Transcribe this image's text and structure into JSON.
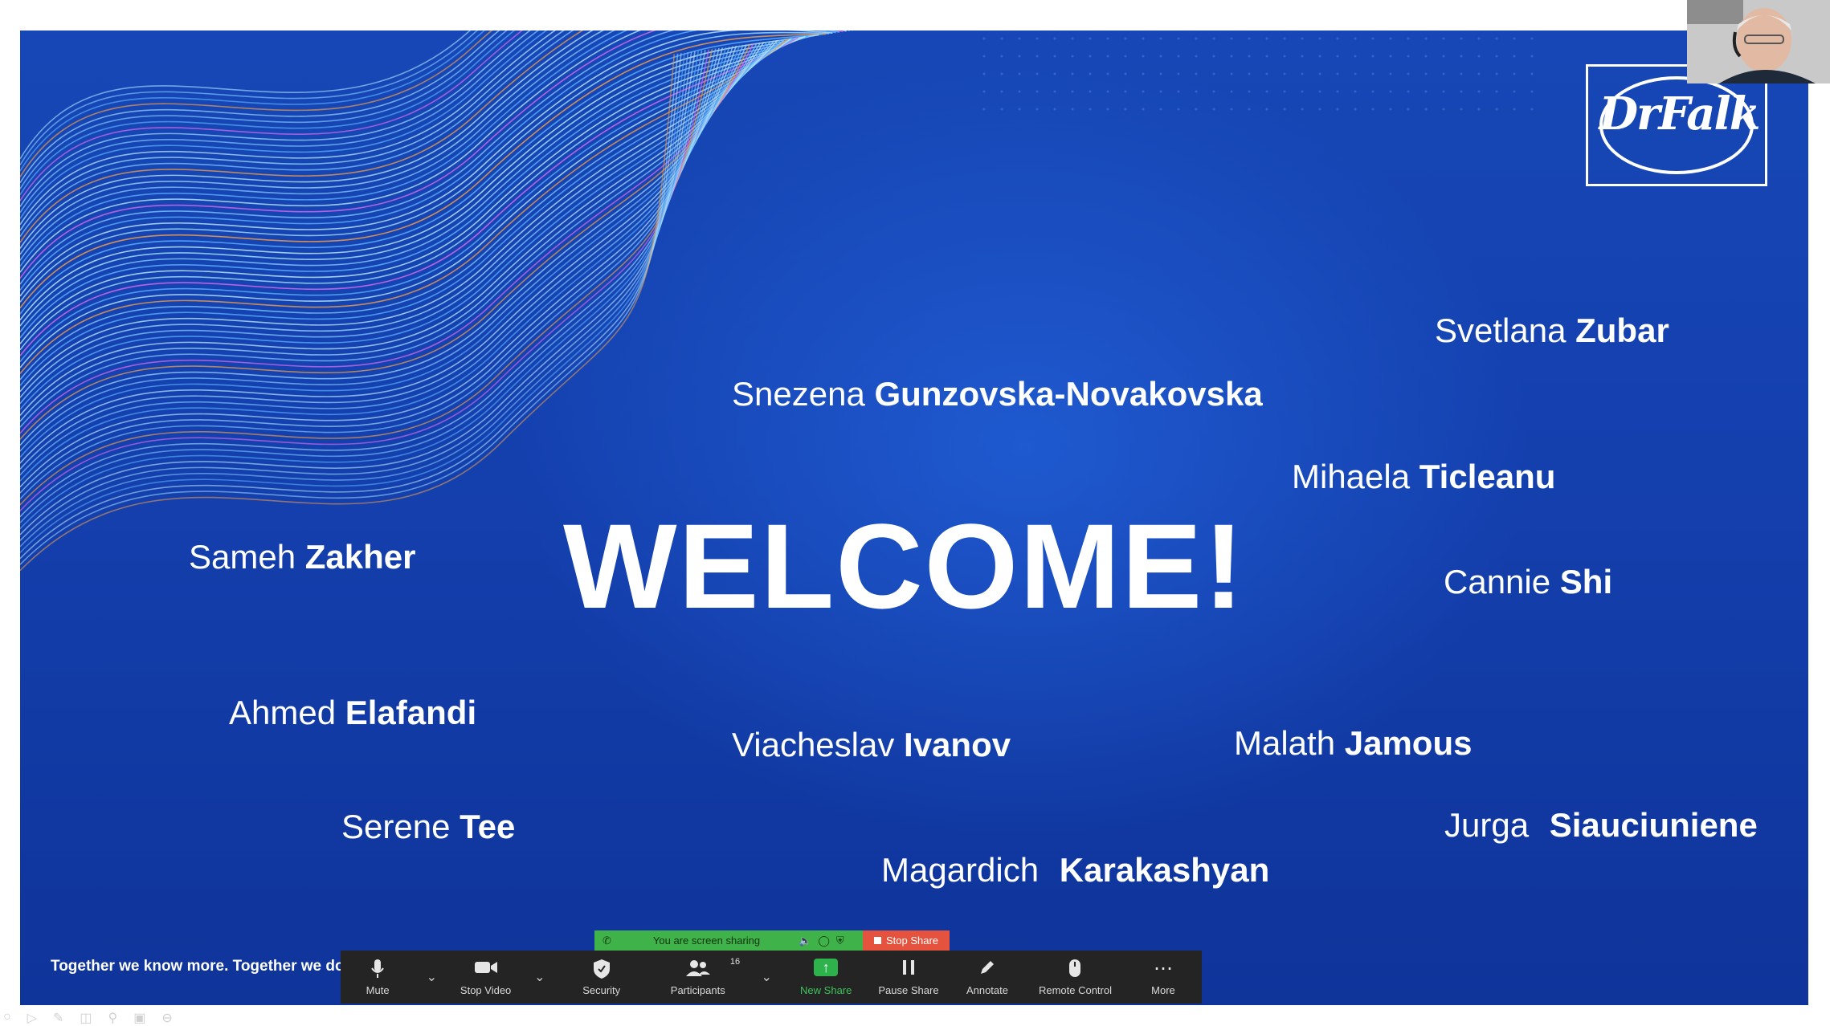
{
  "slide": {
    "headline": "WELCOME!",
    "logo_text": "DrFalk",
    "footer_tagline": "Together we know more. Together we do",
    "attendees": [
      {
        "first": "Svetlana",
        "last": "Zubar"
      },
      {
        "first": "Snezena",
        "last": "Gunzovska-Novakovska"
      },
      {
        "first": "Mihaela",
        "last": "Ticleanu"
      },
      {
        "first": "Sameh",
        "last": "Zakher"
      },
      {
        "first": "Cannie",
        "last": "Shi"
      },
      {
        "first": "Ahmed",
        "last": "Elafandi"
      },
      {
        "first": "Viacheslav",
        "last": "Ivanov"
      },
      {
        "first": "Malath",
        "last": "Jamous"
      },
      {
        "first": "Serene",
        "last": "Tee"
      },
      {
        "first": "Jurga",
        "last": "Siauciuniene"
      },
      {
        "first": "Magardich",
        "last": "Karakashyan"
      }
    ],
    "colors": {
      "background": "#1440ae",
      "text": "#ffffff"
    }
  },
  "share_banner": {
    "status": "You are screen sharing",
    "stop_label": "Stop Share",
    "colors": {
      "banner": "#3fb24a",
      "stop": "#e5533f"
    }
  },
  "toolbar": {
    "items": [
      {
        "label": "Mute",
        "icon": "microphone-icon"
      },
      {
        "label": "Stop Video",
        "icon": "video-camera-icon"
      },
      {
        "label": "Security",
        "icon": "shield-icon"
      },
      {
        "label": "Participants",
        "icon": "participants-icon",
        "count": "16"
      },
      {
        "label": "New Share",
        "icon": "share-screen-icon"
      },
      {
        "label": "Pause Share",
        "icon": "pause-icon"
      },
      {
        "label": "Annotate",
        "icon": "pencil-icon"
      },
      {
        "label": "Remote Control",
        "icon": "mouse-icon"
      },
      {
        "label": "More",
        "icon": "more-icon"
      }
    ],
    "colors": {
      "background": "#242424",
      "active": "#3cc25a"
    }
  }
}
